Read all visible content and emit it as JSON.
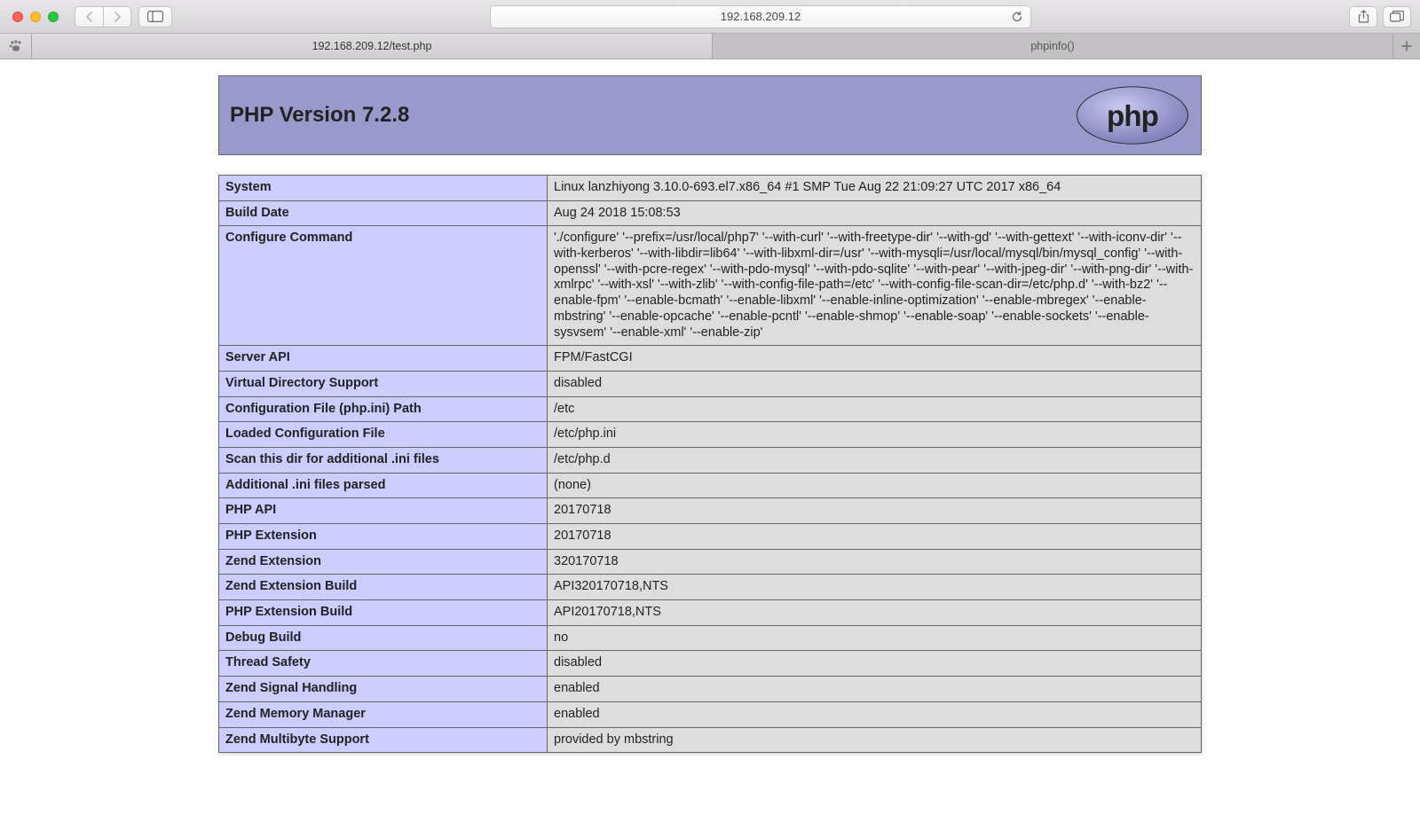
{
  "browser": {
    "address": "192.168.209.12",
    "tabs": [
      {
        "label": "192.168.209.12/test.php",
        "active": true
      },
      {
        "label": "phpinfo()",
        "active": false
      }
    ]
  },
  "phpinfo": {
    "header": "PHP Version 7.2.8",
    "rows": [
      {
        "k": "System",
        "v": "Linux lanzhiyong 3.10.0-693.el7.x86_64 #1 SMP Tue Aug 22 21:09:27 UTC 2017 x86_64"
      },
      {
        "k": "Build Date",
        "v": "Aug 24 2018 15:08:53"
      },
      {
        "k": "Configure Command",
        "v": "'./configure' '--prefix=/usr/local/php7' '--with-curl' '--with-freetype-dir' '--with-gd' '--with-gettext' '--with-iconv-dir' '--with-kerberos' '--with-libdir=lib64' '--with-libxml-dir=/usr' '--with-mysqli=/usr/local/mysql/bin/mysql_config' '--with-openssl' '--with-pcre-regex' '--with-pdo-mysql' '--with-pdo-sqlite' '--with-pear' '--with-jpeg-dir' '--with-png-dir' '--with-xmlrpc' '--with-xsl' '--with-zlib' '--with-config-file-path=/etc' '--with-config-file-scan-dir=/etc/php.d' '--with-bz2' '--enable-fpm' '--enable-bcmath' '--enable-libxml' '--enable-inline-optimization' '--enable-mbregex' '--enable-mbstring' '--enable-opcache' '--enable-pcntl' '--enable-shmop' '--enable-soap' '--enable-sockets' '--enable-sysvsem' '--enable-xml' '--enable-zip'"
      },
      {
        "k": "Server API",
        "v": "FPM/FastCGI"
      },
      {
        "k": "Virtual Directory Support",
        "v": "disabled"
      },
      {
        "k": "Configuration File (php.ini) Path",
        "v": "/etc"
      },
      {
        "k": "Loaded Configuration File",
        "v": "/etc/php.ini"
      },
      {
        "k": "Scan this dir for additional .ini files",
        "v": "/etc/php.d"
      },
      {
        "k": "Additional .ini files parsed",
        "v": "(none)"
      },
      {
        "k": "PHP API",
        "v": "20170718"
      },
      {
        "k": "PHP Extension",
        "v": "20170718"
      },
      {
        "k": "Zend Extension",
        "v": "320170718"
      },
      {
        "k": "Zend Extension Build",
        "v": "API320170718,NTS"
      },
      {
        "k": "PHP Extension Build",
        "v": "API20170718,NTS"
      },
      {
        "k": "Debug Build",
        "v": "no"
      },
      {
        "k": "Thread Safety",
        "v": "disabled"
      },
      {
        "k": "Zend Signal Handling",
        "v": "enabled"
      },
      {
        "k": "Zend Memory Manager",
        "v": "enabled"
      },
      {
        "k": "Zend Multibyte Support",
        "v": "provided by mbstring"
      }
    ]
  }
}
